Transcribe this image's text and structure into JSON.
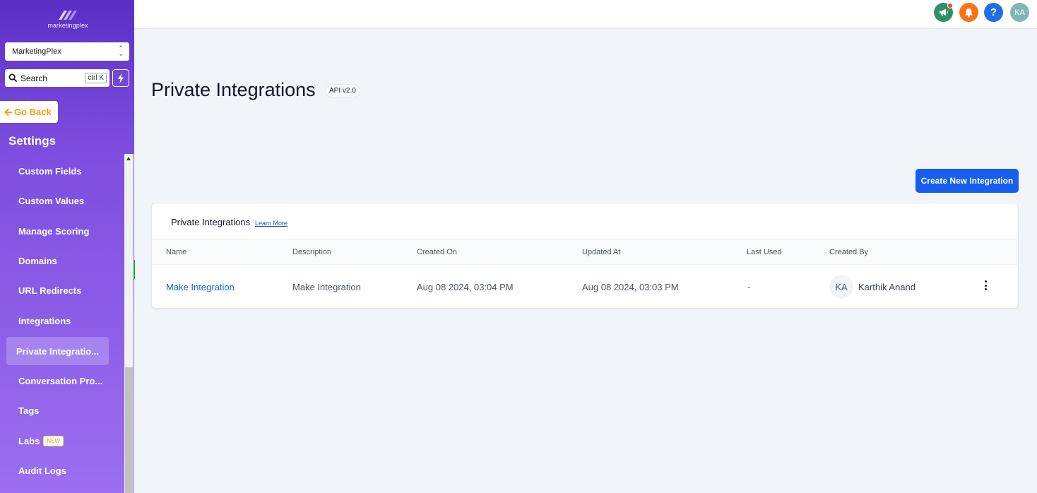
{
  "brand": {
    "name": "marketingplex"
  },
  "account": {
    "selected": "MarketingPlex"
  },
  "search": {
    "placeholder": "Search",
    "shortcut": "ctrl K"
  },
  "sidebar": {
    "go_back": "Go Back",
    "section_title": "Settings",
    "items": [
      {
        "label": "Custom Fields"
      },
      {
        "label": "Custom Values"
      },
      {
        "label": "Manage Scoring"
      },
      {
        "label": "Domains"
      },
      {
        "label": "URL Redirects"
      },
      {
        "label": "Integrations"
      },
      {
        "label": "Private Integratio...",
        "active": true
      },
      {
        "label": "Conversation Pro..."
      },
      {
        "label": "Tags"
      },
      {
        "label": "Labs",
        "badge": "NEW"
      },
      {
        "label": "Audit Logs"
      }
    ]
  },
  "header": {
    "icons": [
      "megaphone-icon",
      "bell-icon",
      "help-icon"
    ],
    "help_glyph": "?",
    "user_initials": "KA"
  },
  "page": {
    "title": "Private Integrations",
    "api_badge": "API v2.0",
    "create_button": "Create New Integration"
  },
  "table": {
    "title": "Private Integrations",
    "learn_more": "Learn More",
    "columns": [
      "Name",
      "Description",
      "Created On",
      "Updated At",
      "Last Used",
      "Created By"
    ],
    "rows": [
      {
        "name": "Make Integration",
        "description": "Make Integration",
        "created_on": "Aug 08 2024, 03:04 PM",
        "updated_at": "Aug 08 2024, 03:03 PM",
        "last_used": "-",
        "created_by_initials": "KA",
        "created_by": "Karthik Anand"
      }
    ]
  },
  "colors": {
    "sidebar_top": "#5b2fc4",
    "sidebar_bottom": "#9b6ff0",
    "primary": "#155eef",
    "go_back": "#f59e0b"
  }
}
